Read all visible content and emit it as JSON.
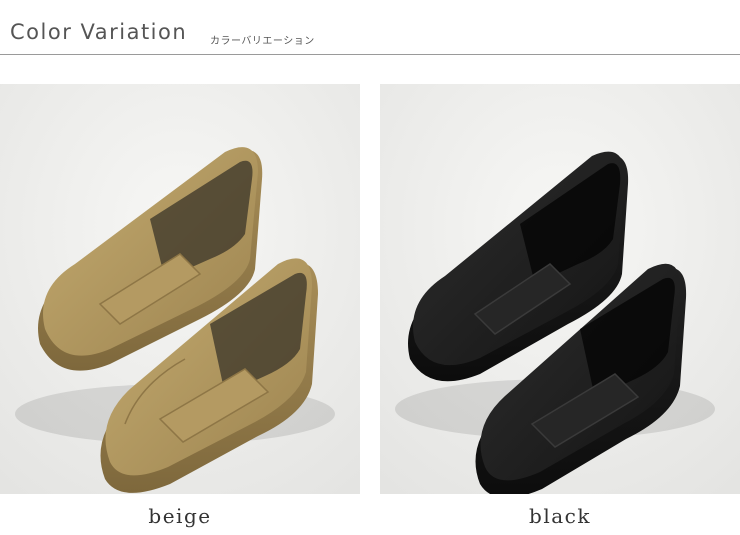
{
  "header": {
    "title": "Color Variation",
    "subtitle": "カラーバリエーション"
  },
  "variants": [
    {
      "label": "beige",
      "color": "#b39a60"
    },
    {
      "label": "black",
      "color": "#1e1e1e"
    }
  ],
  "colors": {
    "background_photo": "#eeeeec",
    "rule": "#9a9a9a",
    "text": "#555555"
  }
}
